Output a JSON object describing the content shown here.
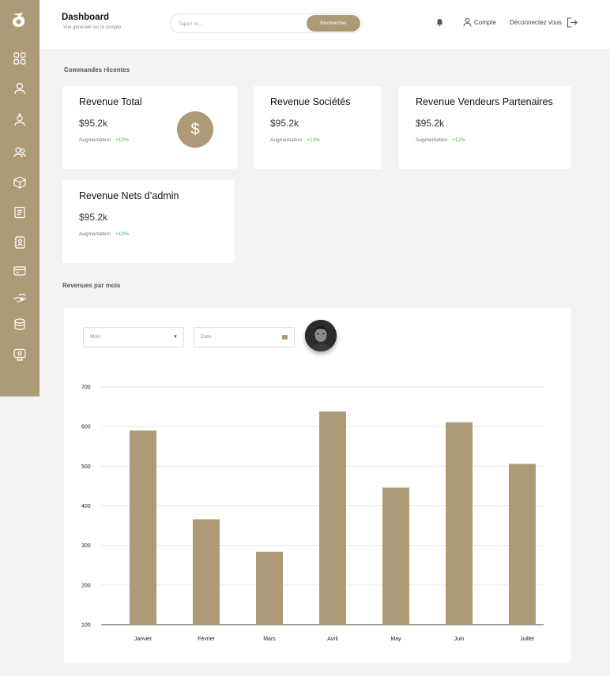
{
  "header": {
    "title": "Dashboard",
    "subtitle": "Vue générale sur le compte",
    "search_placeholder": "Tapez ici...",
    "search_button": "Rechercher",
    "account_label": "Compte",
    "logout_label": "Déconnectez vous"
  },
  "sidebar": {
    "items": [
      {
        "icon": "grid-icon"
      },
      {
        "icon": "user-icon"
      },
      {
        "icon": "user-upload-icon"
      },
      {
        "icon": "users-icon"
      },
      {
        "icon": "box-icon"
      },
      {
        "icon": "document-icon"
      },
      {
        "icon": "contact-book-icon"
      },
      {
        "icon": "card-icon"
      },
      {
        "icon": "hand-icon"
      },
      {
        "icon": "database-icon"
      },
      {
        "icon": "monitor-icon"
      }
    ]
  },
  "sections": {
    "recent_orders": "Commandes récentes",
    "monthly_revenue": "Revenues par mois"
  },
  "cards": [
    {
      "title": "Revenue Total",
      "value": "$95.2k",
      "label": "Augmentation",
      "change": "+12%",
      "icon": "$"
    },
    {
      "title": "Revenue Sociétés",
      "value": "$95.2k",
      "label": "Augmentation",
      "change": "+12%"
    },
    {
      "title": "Revenue Vendeurs Partenaires",
      "value": "$95.2k",
      "label": "Augmentation",
      "change": "+12%"
    },
    {
      "title": "Revenue Nets d’admin",
      "value": "$95.2k",
      "label": "Augmentation",
      "change": "+12%"
    }
  ],
  "filters": {
    "month_select": "Mois",
    "date_field": "Date"
  },
  "colors": {
    "accent": "#ad9b78",
    "positive": "#3cb93c"
  },
  "chart_data": {
    "type": "bar",
    "categories": [
      "Janvier",
      "Février",
      "Mars",
      "Avril",
      "May",
      "Juin",
      "Juillet"
    ],
    "values": [
      590,
      366,
      284,
      638,
      446,
      611,
      506
    ],
    "yticks": [
      100,
      200,
      300,
      400,
      500,
      600,
      700
    ],
    "ylim": [
      100,
      700
    ],
    "grid": true,
    "bar_color": "#ad9b78",
    "title": "",
    "xlabel": "",
    "ylabel": ""
  }
}
